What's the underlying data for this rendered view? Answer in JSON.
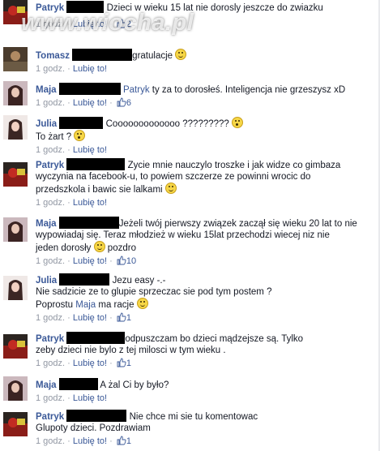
{
  "watermark": "www.wiocha.pl",
  "icons": {
    "like": "thumbs-up-icon",
    "smile": "smile-emoticon-icon",
    "wow": "wow-emoticon-icon"
  },
  "colors": {
    "link": "#3b5998",
    "meta": "#9197a3",
    "text": "#141823",
    "censor": "#000000"
  },
  "comments": [
    {
      "author": "Patryk",
      "p1": "Dzieci w wieku 15 lat nie dorosly jeszcze do zwiazku",
      "p2": "",
      "p3": "",
      "mention": "",
      "after": "",
      "time": "1 godz.",
      "like": "Lubię to!",
      "likes": "2"
    },
    {
      "author": "Tomasz",
      "p1": "gratulacje ",
      "p2": "",
      "p3": "",
      "mention": "",
      "after": "",
      "time": "1 godz.",
      "like": "Lubię to!",
      "likes": ""
    },
    {
      "author": "Maja",
      "mention": "Patryk",
      "after": " ty za to dorosłeś. Inteligencja nie grzeszysz xD",
      "p1": "",
      "p2": "",
      "p3": "",
      "time": "1 godz.",
      "like": "Lubię to!",
      "likes": "6"
    },
    {
      "author": "Julia",
      "p1": "Cooooooooooooo ????????? ",
      "p2": "To żart ? ",
      "p3": "",
      "mention": "",
      "after": "",
      "time": "1 godz.",
      "like": "Lubię to!",
      "likes": ""
    },
    {
      "author": "Patryk",
      "p1": "Zycie mnie nauczylo troszke i jak widze co gimbaza",
      "p2": "wyczynia na facebook-u, to powiem szczerze ze powinni wrocic do",
      "p3": "przedszkola i bawic sie lalkami ",
      "mention": "",
      "after": "",
      "time": "1 godz.",
      "like": "Lubię to!",
      "likes": ""
    },
    {
      "author": "Maja",
      "p1": "Jeżeli twój pierwszy związek zaczął się wieku 20 lat to nie",
      "p2": "wypowiadaj się. Teraz młodzież w wieku 15lat przechodzi wiecej niz nie",
      "p3": "jeden dorosły ",
      "p4": " pozdro",
      "mention": "",
      "after": "",
      "time": "1 godz.",
      "like": "Lubię to!",
      "likes": "10"
    },
    {
      "author": "Julia",
      "p1": "Jezu easy -.-",
      "p2": "Nie sadzicie ze to glupie sprzeczac sie pod tym postem ?",
      "p3": "Poprostu ",
      "mention": "Maja",
      "after": " ma racje ",
      "time": "1 godz.",
      "like": "Lubię to!",
      "likes": "1"
    },
    {
      "author": "Patryk",
      "p1": "odpuszczam bo dzieci mądzejsze są. Tylko",
      "p2": "zeby dzieci nie bylo z tej milosci w tym wieku   .",
      "p3": "",
      "mention": "",
      "after": "",
      "time": "1 godz.",
      "like": "Lubię to!",
      "likes": "1"
    },
    {
      "author": "Maja",
      "p1": "A żal Ci by było?",
      "p2": "",
      "p3": "",
      "mention": "",
      "after": "",
      "time": "1 godz.",
      "like": "Lubię to!",
      "likes": ""
    },
    {
      "author": "Patryk",
      "p1": "Nie chce mi sie tu komentowac",
      "p2": "Glupoty dzieci. Pozdrawiam",
      "p3": "",
      "mention": "",
      "after": "",
      "time": "1 godz.",
      "like": "Lubię to!",
      "likes": "1"
    }
  ]
}
